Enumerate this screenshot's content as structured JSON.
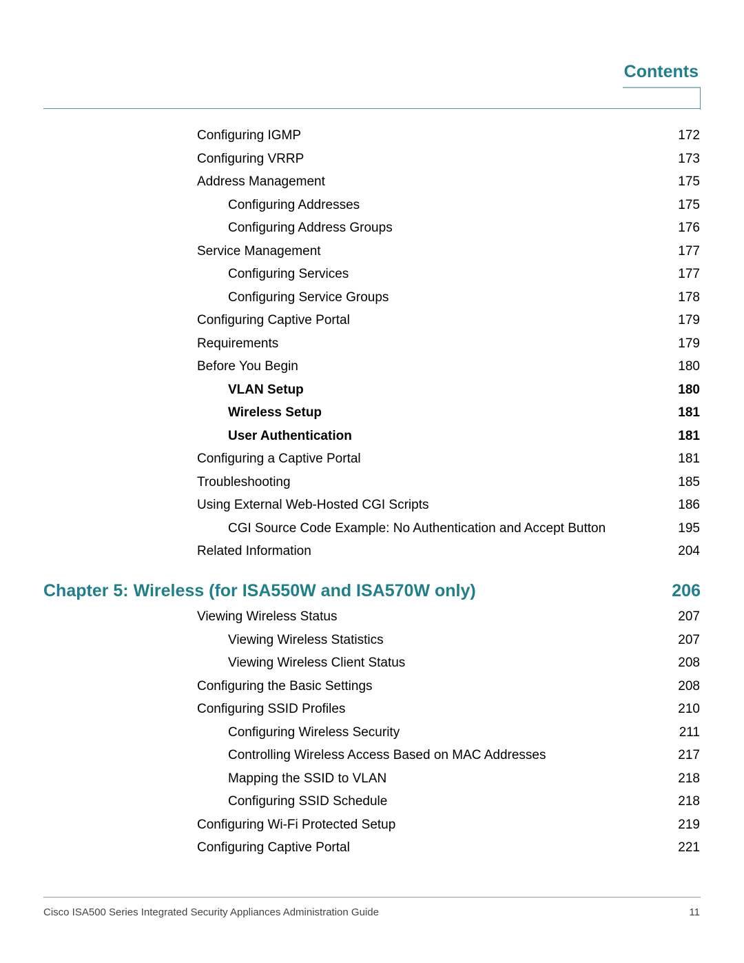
{
  "header": {
    "title": "Contents"
  },
  "entries_before": [
    {
      "title": "Configuring IGMP",
      "page": "172",
      "level": 1
    },
    {
      "title": "Configuring VRRP",
      "page": "173",
      "level": 1
    },
    {
      "title": "Address Management",
      "page": "175",
      "level": 1
    },
    {
      "title": "Configuring Addresses",
      "page": "175",
      "level": 2
    },
    {
      "title": "Configuring Address Groups",
      "page": "176",
      "level": 2
    },
    {
      "title": "Service Management",
      "page": "177",
      "level": 1
    },
    {
      "title": "Configuring Services",
      "page": "177",
      "level": 2
    },
    {
      "title": "Configuring Service Groups",
      "page": "178",
      "level": 2
    },
    {
      "title": "Configuring Captive Portal",
      "page": "179",
      "level": 1
    },
    {
      "title": "Requirements",
      "page": "179",
      "level": 1
    },
    {
      "title": "Before You Begin",
      "page": "180",
      "level": 1
    },
    {
      "title": "VLAN Setup",
      "page": "180",
      "level": 2,
      "bold": true
    },
    {
      "title": "Wireless Setup",
      "page": "181",
      "level": 2,
      "bold": true
    },
    {
      "title": "User Authentication",
      "page": "181",
      "level": 2,
      "bold": true
    },
    {
      "title": "Configuring a Captive Portal",
      "page": "181",
      "level": 1
    },
    {
      "title": "Troubleshooting",
      "page": "185",
      "level": 1
    },
    {
      "title": "Using External Web-Hosted CGI Scripts",
      "page": "186",
      "level": 1
    },
    {
      "title": "CGI Source Code Example: No Authentication and Accept Button",
      "page": "195",
      "level": 2
    },
    {
      "title": "Related Information",
      "page": "204",
      "level": 1
    }
  ],
  "chapter": {
    "title": "Chapter 5: Wireless (for ISA550W and ISA570W only)",
    "page": "206"
  },
  "entries_after": [
    {
      "title": "Viewing Wireless Status",
      "page": "207",
      "level": 1
    },
    {
      "title": "Viewing Wireless Statistics",
      "page": "207",
      "level": 2
    },
    {
      "title": "Viewing Wireless Client Status",
      "page": "208",
      "level": 2
    },
    {
      "title": "Configuring the Basic Settings",
      "page": "208",
      "level": 1
    },
    {
      "title": "Configuring SSID Profiles",
      "page": "210",
      "level": 1
    },
    {
      "title": "Configuring Wireless Security",
      "page": "211",
      "level": 2
    },
    {
      "title": "Controlling Wireless Access Based on MAC Addresses",
      "page": "217",
      "level": 2
    },
    {
      "title": "Mapping the SSID to VLAN",
      "page": "218",
      "level": 2
    },
    {
      "title": "Configuring SSID Schedule",
      "page": "218",
      "level": 2
    },
    {
      "title": "Configuring Wi-Fi Protected Setup",
      "page": "219",
      "level": 1
    },
    {
      "title": "Configuring Captive Portal",
      "page": "221",
      "level": 1
    }
  ],
  "footer": {
    "text": "Cisco ISA500 Series Integrated Security Appliances Administration Guide",
    "page_number": "11"
  },
  "colors": {
    "accent": "#1f7f8a",
    "rule": "#4a8fb5"
  }
}
